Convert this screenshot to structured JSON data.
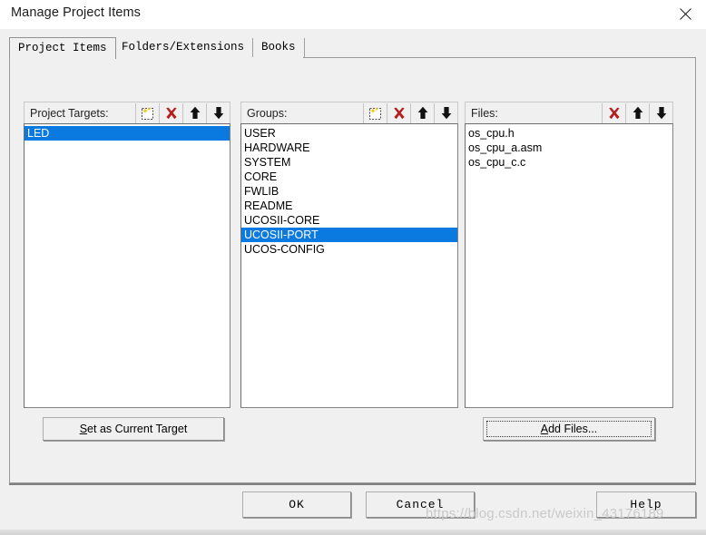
{
  "window": {
    "title": "Manage Project Items",
    "close_icon": "close-icon"
  },
  "tabs": [
    {
      "label": "Project Items",
      "active": true
    },
    {
      "label": "Folders/Extensions",
      "active": false
    },
    {
      "label": "Books",
      "active": false
    }
  ],
  "panels": {
    "project_targets": {
      "header_label": "Project Targets:",
      "tools": [
        {
          "name": "new-item-icon",
          "title": "New (Insert)"
        },
        {
          "name": "delete-item-icon",
          "title": "Remove"
        },
        {
          "name": "move-up-icon",
          "title": "Move Up"
        },
        {
          "name": "move-down-icon",
          "title": "Move Down"
        }
      ],
      "items": [
        {
          "label": "LED",
          "selected": true
        }
      ]
    },
    "groups": {
      "header_label": "Groups:",
      "tools": [
        {
          "name": "new-item-icon",
          "title": "New (Insert)"
        },
        {
          "name": "delete-item-icon",
          "title": "Remove"
        },
        {
          "name": "move-up-icon",
          "title": "Move Up"
        },
        {
          "name": "move-down-icon",
          "title": "Move Down"
        }
      ],
      "items": [
        {
          "label": "USER",
          "selected": false
        },
        {
          "label": "HARDWARE",
          "selected": false
        },
        {
          "label": "SYSTEM",
          "selected": false
        },
        {
          "label": "CORE",
          "selected": false
        },
        {
          "label": "FWLIB",
          "selected": false
        },
        {
          "label": "README",
          "selected": false
        },
        {
          "label": "UCOSII-CORE",
          "selected": false
        },
        {
          "label": "UCOSII-PORT",
          "selected": true
        },
        {
          "label": "UCOS-CONFIG",
          "selected": false
        }
      ]
    },
    "files": {
      "header_label": "Files:",
      "tools": [
        {
          "name": "delete-item-icon",
          "title": "Remove"
        },
        {
          "name": "move-up-icon",
          "title": "Move Up"
        },
        {
          "name": "move-down-icon",
          "title": "Move Down"
        }
      ],
      "items": [
        {
          "label": "os_cpu.h",
          "selected": false
        },
        {
          "label": "os_cpu_a.asm",
          "selected": false
        },
        {
          "label": "os_cpu_c.c",
          "selected": false
        }
      ]
    }
  },
  "buttons": {
    "set_as_current_target": {
      "accel": "S",
      "rest": "et as Current Target"
    },
    "add_files": {
      "accel": "A",
      "rest": "dd Files..."
    },
    "ok": "OK",
    "cancel": "Cancel",
    "help": "Help"
  },
  "watermark": "https://blog.csdn.net/weixin_43176189",
  "colors": {
    "selection_blue": "#0a7ae0",
    "dialog_face": "#f0f0f0",
    "listbox_bg": "#ffffff",
    "delete_red": "#b4201f"
  }
}
